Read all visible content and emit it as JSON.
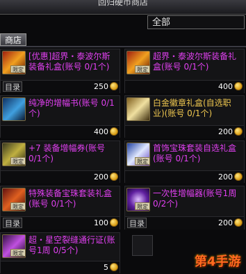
{
  "window": {
    "title": "回归硬币商店"
  },
  "filter": {
    "value": "全部"
  },
  "tab": {
    "label": "商店"
  },
  "limit_badge": "限定",
  "catalog_label": "目录",
  "items": [
    {
      "name": "[优惠]超界・泰波尔斯装备礼盒(账号 0/1个)",
      "price": "250",
      "color": "#e040f0",
      "icon": "box-icon"
    },
    {
      "name": "超界・泰波尔斯装备礼盒(账号 0/1个)",
      "price": "400",
      "color": "#e040f0",
      "icon": "box-icon"
    },
    {
      "name": "纯净的增幅书(账号 0/1个)",
      "price": "400",
      "color": "#e040f0",
      "icon": "book-icon"
    },
    {
      "name": "白金徽章礼盒(自选职业)(账号 0/1个)",
      "price": "200",
      "color": "#f0c850",
      "icon": "box-icon"
    },
    {
      "name": "+7 装备增幅券(账号 0/1个)",
      "price": "200",
      "color": "#e040f0",
      "icon": "ticket-icon"
    },
    {
      "name": "首饰宝珠套装自选礼盒(账号 0/1个)",
      "price": "200",
      "color": "#e040f0",
      "icon": "box-icon"
    },
    {
      "name": "特殊装备宝珠套装礼盒(账号 0/1个)",
      "price": "100",
      "color": "#e040f0",
      "icon": "box-icon"
    },
    {
      "name": "一次性增幅器(账号1周 0/2个)",
      "price": "200",
      "color": "#e040f0",
      "icon": "amplifier-icon"
    },
    {
      "name": "超・星空裂缝通行证(账号1周 0/5个)",
      "price": "5",
      "color": "#e040f0",
      "icon": "pass-icon"
    }
  ],
  "watermark": "第4手游"
}
